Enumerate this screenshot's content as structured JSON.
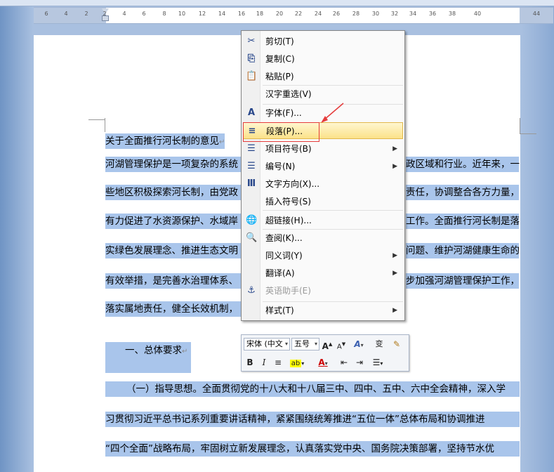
{
  "ruler": {
    "ticks": [
      "6",
      "4",
      "2",
      "2",
      "4",
      "6",
      "8",
      "10",
      "12",
      "14",
      "16",
      "18",
      "20",
      "22",
      "24",
      "26",
      "28",
      "30",
      "32",
      "34",
      "36",
      "38",
      "40",
      "44"
    ]
  },
  "document": {
    "lines": [
      "关于全面推行河长制的意见",
      "河湖管理保护是一项复杂的系统",
      "政区域和行业。近年来，一",
      "些地区积极探索河长制，由党政",
      "责任，协调整合各方力量，",
      "有力促进了水资源保护、水域岸",
      "工作。全面推行河长制是落",
      "实绿色发展理念、推进生态文明",
      "问题、维护河湖健康生命的",
      "有效举措，是完善水治理体系、",
      "步加强河湖管理保护工作，",
      "落实属地责任，健全长效机制，",
      "一、总体要求",
      "（一）指导思想。全面贯彻党的十八大和十八届三中、四中、五中、六中全会精神，深入学",
      "习贯彻习近平总书记系列重要讲话精神，紧紧围绕统筹推进“五位一体”总体布局和协调推进",
      "“四个全面”战略布局，牢固树立新发展理念，认真落实党中央、国务院决策部署，坚持节水优"
    ],
    "para_mark": "↵"
  },
  "context_menu": {
    "items": [
      {
        "label": "剪切(T)",
        "icon": "scissors-icon",
        "glyph": "✂"
      },
      {
        "label": "复制(C)",
        "icon": "copy-icon",
        "glyph": "⎘"
      },
      {
        "label": "粘贴(P)",
        "icon": "paste-icon",
        "glyph": "📋"
      },
      {
        "label": "汉字重选(V)",
        "icon": "",
        "glyph": ""
      },
      {
        "label": "字体(F)...",
        "icon": "font-icon",
        "glyph": "A"
      },
      {
        "label": "段落(P)...",
        "icon": "paragraph-icon",
        "glyph": "≡"
      },
      {
        "label": "项目符号(B)",
        "icon": "bullets-icon",
        "glyph": "☰"
      },
      {
        "label": "编号(N)",
        "icon": "numbering-icon",
        "glyph": "☰"
      },
      {
        "label": "文字方向(X)...",
        "icon": "text-direction-icon",
        "glyph": "Ⅲ"
      },
      {
        "label": "插入符号(S)",
        "icon": "",
        "glyph": ""
      },
      {
        "label": "超链接(H)...",
        "icon": "hyperlink-icon",
        "glyph": "🌐"
      },
      {
        "label": "查阅(K)...",
        "icon": "research-icon",
        "glyph": "🔍"
      },
      {
        "label": "同义词(Y)",
        "icon": "",
        "glyph": ""
      },
      {
        "label": "翻译(A)",
        "icon": "",
        "glyph": ""
      },
      {
        "label": "英语助手(E)",
        "icon": "english-assistant-icon",
        "glyph": "⚓"
      },
      {
        "label": "样式(T)",
        "icon": "",
        "glyph": ""
      }
    ],
    "submenu_arrow": "▶"
  },
  "mini_toolbar": {
    "font": "宋体 (中文",
    "size": "五号",
    "grow": "A",
    "shrink": "A",
    "wen": "变",
    "bold": "B",
    "italic": "I",
    "color_a": "A",
    "dropdown": "▾"
  },
  "colors": {
    "selection": "#a9c5eb",
    "highlight_border": "#e2b84c",
    "annotation_red": "#e53c3c"
  }
}
